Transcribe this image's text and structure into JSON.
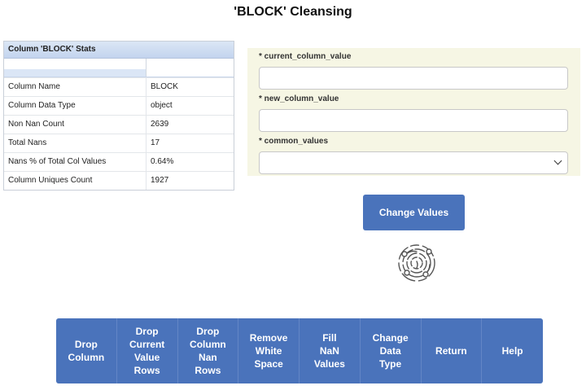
{
  "page": {
    "title": "'BLOCK' Cleansing"
  },
  "stats": {
    "header": "Column 'BLOCK' Stats",
    "rows": [
      {
        "label": "Column Name",
        "value": "BLOCK"
      },
      {
        "label": "Column Data Type",
        "value": "object"
      },
      {
        "label": "Non Nan Count",
        "value": "2639"
      },
      {
        "label": "Total Nans",
        "value": "17"
      },
      {
        "label": "Nans % of Total Col Values",
        "value": "0.64%"
      },
      {
        "label": "Column Uniques Count",
        "value": "1927"
      }
    ]
  },
  "form": {
    "current_label": "* current_column_value",
    "current_value": "",
    "new_label": "* new_column_value",
    "new_value": "",
    "common_label": "* common_values",
    "common_selected": ""
  },
  "change_button": {
    "label": "Change Values"
  },
  "icons": {
    "fingerprint": "fingerprint-icon",
    "dropdown": "chevron-down-icon"
  },
  "colors": {
    "button": "#4a73bb",
    "panel": "#f6f6e4"
  },
  "toolbar": [
    {
      "label": "Drop\nColumn"
    },
    {
      "label": "Drop\nCurrent\nValue\nRows"
    },
    {
      "label": "Drop\nColumn\nNan\nRows"
    },
    {
      "label": "Remove\nWhite\nSpace"
    },
    {
      "label": "Fill\nNaN\nValues"
    },
    {
      "label": "Change\nData\nType"
    },
    {
      "label": "Return"
    },
    {
      "label": "Help"
    }
  ]
}
